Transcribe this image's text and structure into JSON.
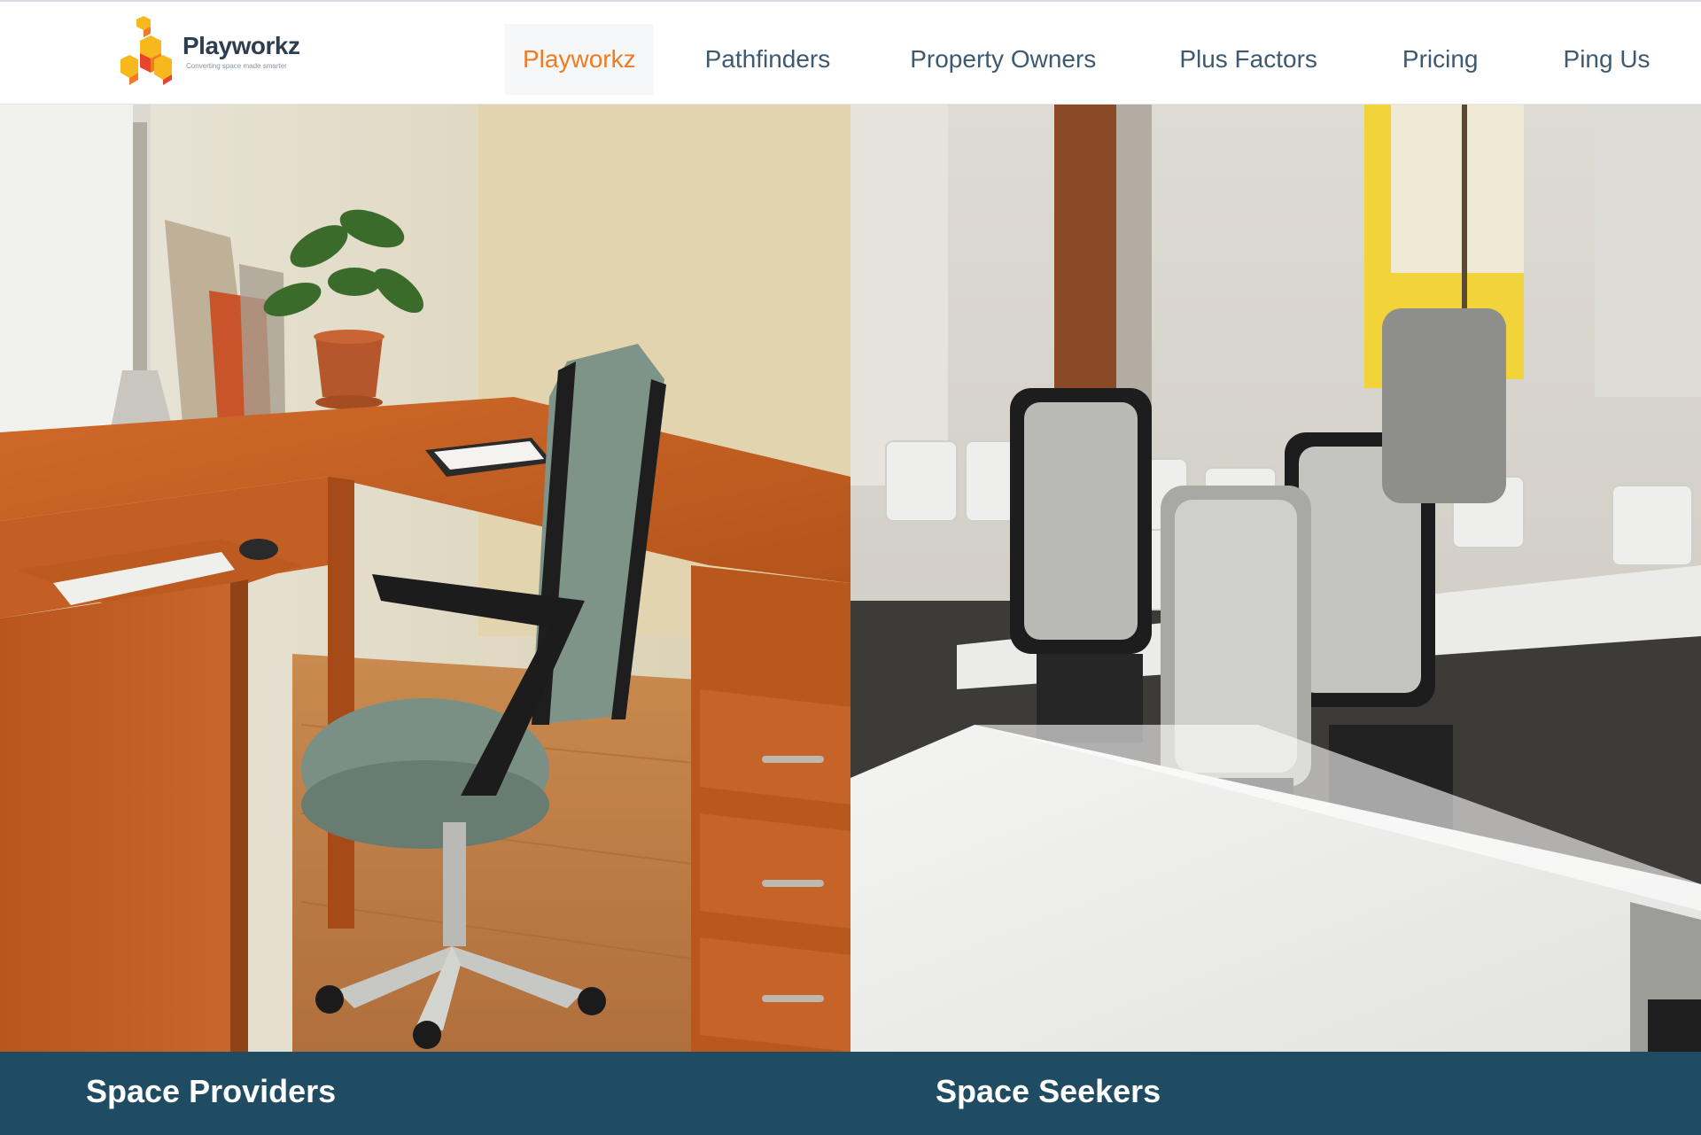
{
  "brand": {
    "name": "Playworkz",
    "tagline": "Converting space made smarter",
    "colors": {
      "orange": "#ef7b23",
      "yellow": "#f6b81c",
      "red": "#e8442a",
      "navy": "#1f4b63"
    }
  },
  "nav": {
    "items": [
      {
        "label": "Playworkz",
        "active": true
      },
      {
        "label": "Pathfinders",
        "active": false
      },
      {
        "label": "Property Owners",
        "active": false
      },
      {
        "label": "Plus Factors",
        "active": false
      },
      {
        "label": "Pricing",
        "active": false
      },
      {
        "label": "Ping Us",
        "active": false
      }
    ]
  },
  "panels": {
    "left": {
      "image": "office-desk-chair-photo",
      "title": "Space Providers"
    },
    "right": {
      "image": "coworking-room-chairs-photo",
      "title": "Space Seekers"
    }
  }
}
